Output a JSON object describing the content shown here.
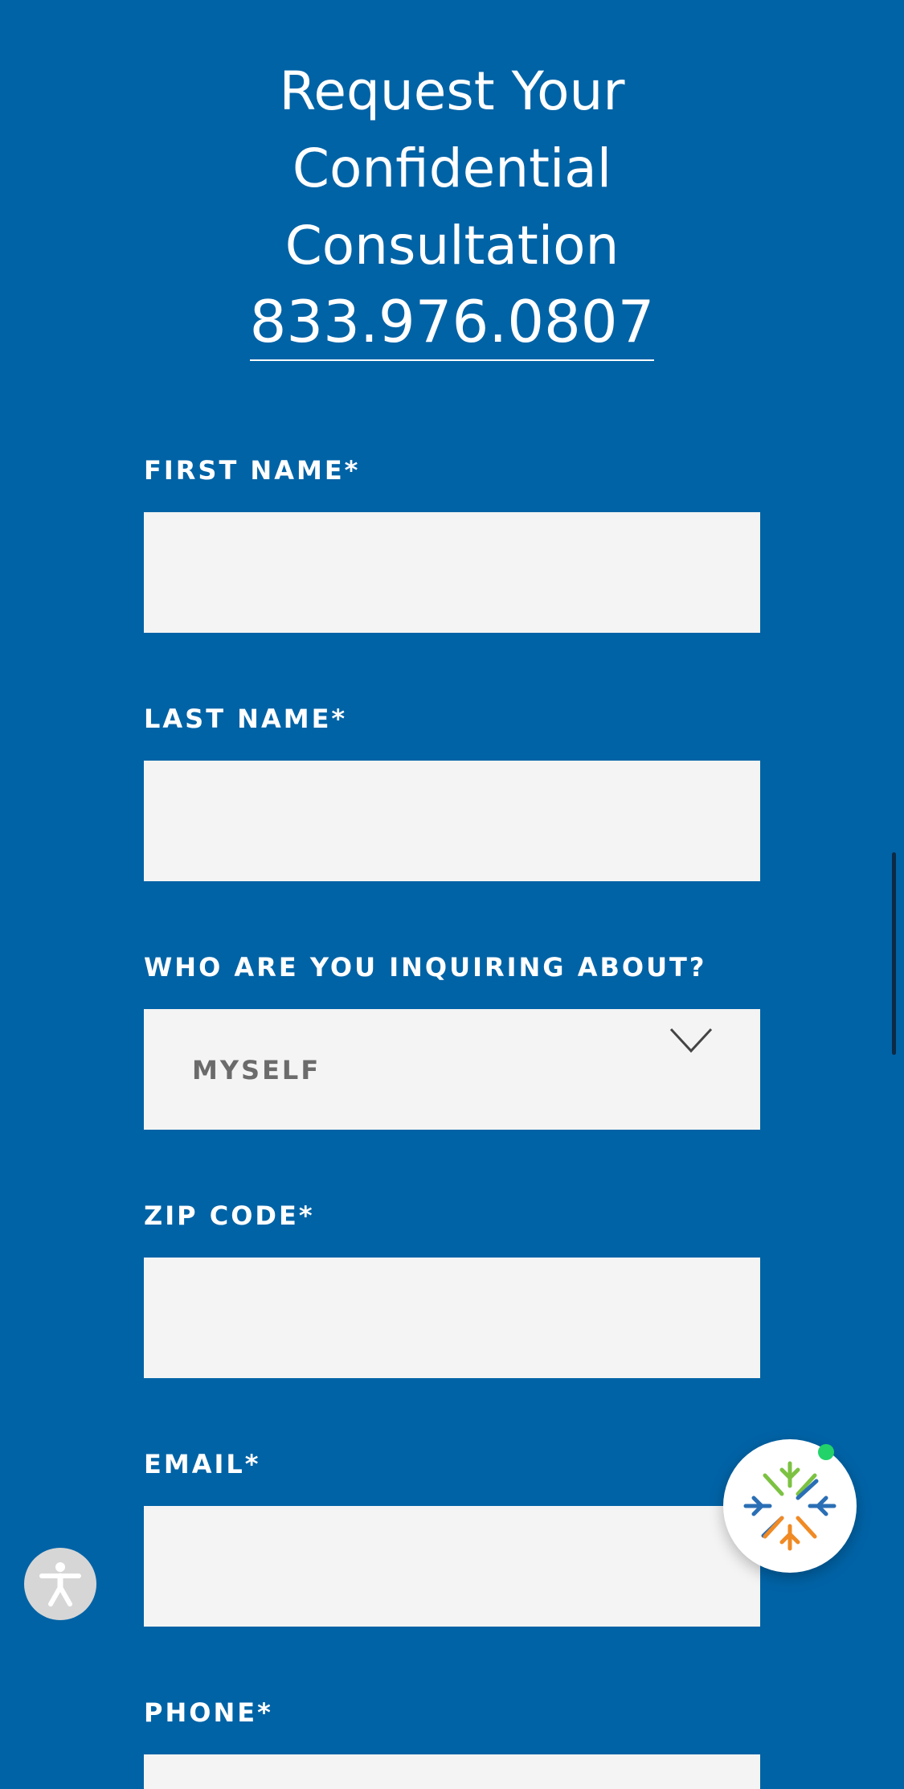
{
  "heading": {
    "line1": "Request Your",
    "line2": "Confidential",
    "line3": "Consultation",
    "phone": "833.976.0807"
  },
  "form": {
    "first_name_label": "FIRST NAME*",
    "last_name_label": "LAST NAME*",
    "inquiring_label": "WHO ARE YOU INQUIRING ABOUT?",
    "inquiring_selected": "MYSELF",
    "zip_label": "ZIP CODE*",
    "email_label": "EMAIL*",
    "phone_label": "PHONE*",
    "first_name_value": "",
    "last_name_value": "",
    "zip_value": "",
    "email_value": "",
    "phone_value": ""
  },
  "widgets": {
    "accessibility_icon": "accessibility-icon",
    "chat_icon": "chat-logo-icon",
    "chat_status_color": "#22d36a"
  },
  "colors": {
    "background": "#0063a6",
    "field": "#f4f4f4",
    "text": "#ffffff",
    "select_text": "#6b6b6b"
  }
}
